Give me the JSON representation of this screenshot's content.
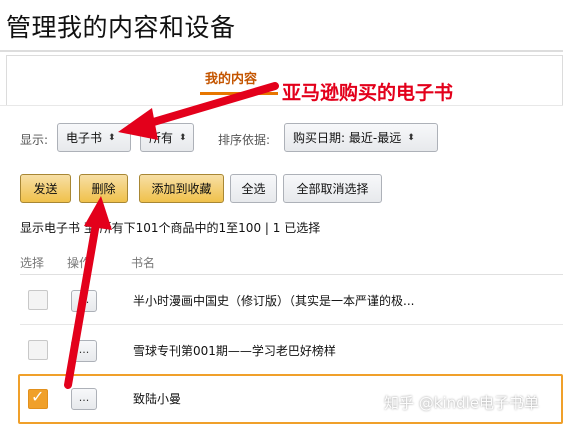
{
  "page": {
    "title": "管理我的内容和设备"
  },
  "tabs": {
    "active_label": "我的内容"
  },
  "annotation": {
    "text": "亚马逊购买的电子书"
  },
  "filters": {
    "show_label": "显示:",
    "show_value": "电子书",
    "scope_value": "所有",
    "sort_label": "排序依据:",
    "sort_value": "购买日期: 最近-最远"
  },
  "toolbar": {
    "send": "发送",
    "delete": "删除",
    "add_to_collection": "添加到收藏",
    "select_all": "全选",
    "deselect_all": "全部取消选择"
  },
  "summary": {
    "text": "显示电子书 至 所有下101个商品中的1至100 | 1 已选择"
  },
  "table": {
    "headers": {
      "select": "选择",
      "action": "操作",
      "title": "书名"
    },
    "rows": [
      {
        "title": "半小时漫画中国史（修订版）（其实是一本严谨的极...",
        "checked": false,
        "action": "..."
      },
      {
        "title": "雪球专刊第001期——学习老巴好榜样",
        "checked": false,
        "action": "..."
      },
      {
        "title": "致陆小曼",
        "checked": true,
        "action": "..."
      }
    ]
  },
  "watermark": {
    "text": "知乎 @kindle电子书单"
  },
  "colors": {
    "accent": "#f0c14b",
    "tab_orange": "#c45500",
    "annotation_red": "#e3001b",
    "checkbox_checked": "#f0a02a"
  },
  "icons": {
    "select_chevron": "updown-chevron-icon",
    "checkmark": "check-icon"
  }
}
